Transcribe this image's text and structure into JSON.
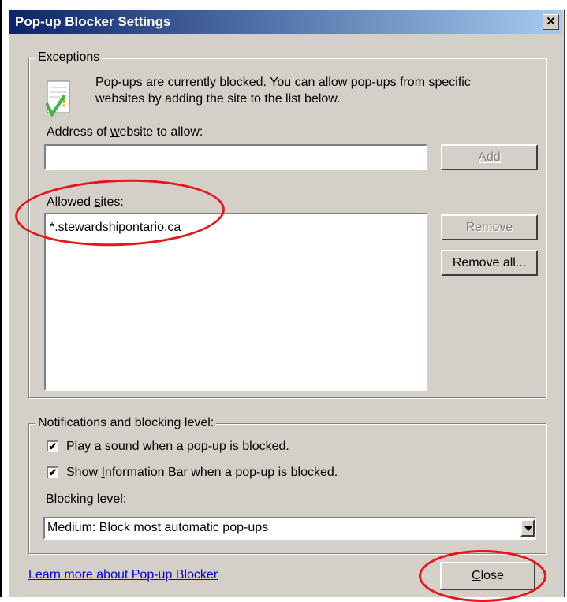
{
  "window": {
    "title": "Pop-up Blocker Settings"
  },
  "exceptions": {
    "legend": "Exceptions",
    "info_text_line1": "Pop-ups are currently blocked.  You can allow pop-ups from specific",
    "info_text_line2": "websites by adding the site to the list below.",
    "address_label": "Address of website to allow:",
    "address_value": "",
    "add_button": "Add",
    "allowed_label": "Allowed sites:",
    "allowed_sites": [
      "*.stewardshipontario.ca"
    ],
    "remove_button": "Remove",
    "remove_all_button": "Remove all..."
  },
  "notifications": {
    "legend": "Notifications and blocking level:",
    "play_sound_label": "Play a sound when a pop-up is blocked.",
    "play_sound_checked": "✔",
    "info_bar_label": "Show Information Bar when a pop-up is blocked.",
    "info_bar_checked": "✔",
    "blocking_level_label": "Blocking level:",
    "blocking_level_value": "Medium: Block most automatic pop-ups"
  },
  "footer": {
    "learn_more_link": "Learn more about Pop-up Blocker",
    "close_button": "Close"
  },
  "colors": {
    "annotation": "#e8141c",
    "titlebar": "#0a246a",
    "dialog_bg": "#d4d0c8"
  }
}
